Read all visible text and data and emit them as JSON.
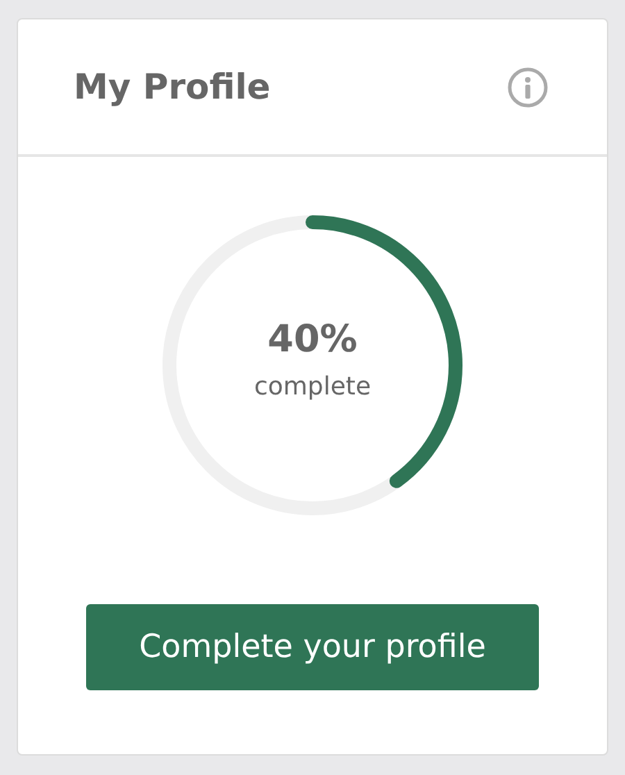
{
  "card": {
    "title": "My Profile"
  },
  "progress": {
    "value": "40%",
    "caption": "complete"
  },
  "button": {
    "label": "Complete your profile"
  }
}
